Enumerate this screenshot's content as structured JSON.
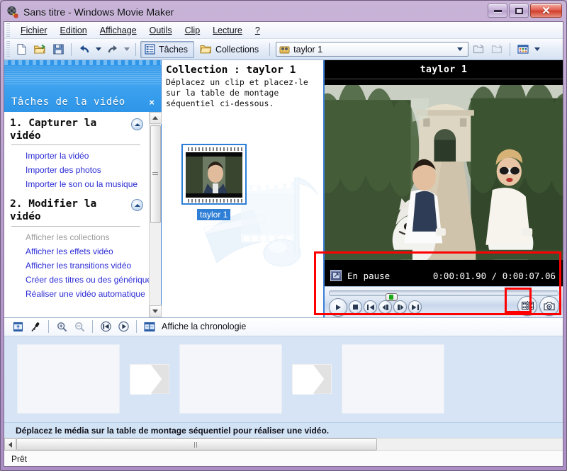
{
  "window": {
    "title": "Sans titre - Windows Movie Maker",
    "app_icon": "movie-reel-icon",
    "minimize": "Réduire",
    "restore": "Agrandir",
    "close": "Fermer"
  },
  "menu": [
    {
      "label": "Fichier",
      "accel": "F"
    },
    {
      "label": "Edition",
      "accel": "E"
    },
    {
      "label": "Affichage",
      "accel": "A"
    },
    {
      "label": "Outils",
      "accel": "O"
    },
    {
      "label": "Clip",
      "accel": "C"
    },
    {
      "label": "Lecture",
      "accel": "L"
    },
    {
      "label": "?",
      "accel": ""
    }
  ],
  "toolbar": {
    "new_title": "Nouveau projet",
    "open_title": "Ouvrir le projet",
    "save_title": "Enregistrer le projet",
    "undo_title": "Annuler",
    "redo_title": "Rétablir",
    "tasks_label": "Tâches",
    "collections_label": "Collections",
    "collection_value": "taylor 1",
    "views_title": "Affichages"
  },
  "task_pane": {
    "title": "Tâches de la vidéo",
    "close": "×",
    "sections": [
      {
        "heading": "1. Capturer la vidéo",
        "links": [
          {
            "label": "Importer la vidéo",
            "disabled": false
          },
          {
            "label": "Importer des photos",
            "disabled": false
          },
          {
            "label": "Importer le son ou la musique",
            "disabled": false
          }
        ]
      },
      {
        "heading": "2. Modifier la vidéo",
        "links": [
          {
            "label": "Afficher les collections",
            "disabled": true
          },
          {
            "label": "Afficher les effets vidéo",
            "disabled": false
          },
          {
            "label": "Afficher les transitions vidéo",
            "disabled": false
          },
          {
            "label": "Créer des titres ou des génériques",
            "disabled": false
          },
          {
            "label": "Réaliser une vidéo automatique",
            "disabled": false
          }
        ]
      }
    ]
  },
  "collections": {
    "heading": "Collection : taylor 1",
    "hint": "Déplacez un clip et placez-le sur la table de montage séquentiel ci-dessous.",
    "clips": [
      {
        "label": "taylor 1",
        "selected": true
      }
    ]
  },
  "preview": {
    "title": "taylor 1",
    "status_icon": "display-icon",
    "status": "En pause",
    "current_time": "0:00:01.90",
    "separator": "/",
    "total_time": "0:00:07.06",
    "seek_percent": 27,
    "buttons": {
      "play": "Lecture",
      "stop": "Arrêter",
      "prev_frame_back": "Clip précédent",
      "back_frame": "Image précédente",
      "fwd_frame": "Image suivante",
      "next_clip": "Clip suivant",
      "split": "Fractionner le clip",
      "snapshot": "Prendre une photo"
    }
  },
  "storyboard": {
    "toolbar": {
      "storyboard_title": "Table de montage séquentiel",
      "narrate_title": "Narration de la chronologie",
      "zoom_in_title": "Zoom avant",
      "zoom_out_title": "Zoom arrière",
      "rewind_title": "Rembobiner la chronologie",
      "play_title": "Lire la chronologie",
      "view_label": "Affiche la chronologie"
    },
    "hint": "Déplacez le média sur la table de montage séquentiel pour réaliser une vidéo.",
    "cells": [
      "",
      "",
      ""
    ],
    "scroll_percent": 66
  },
  "status_bar": {
    "text": "Prêt"
  },
  "annotations": [
    {
      "name": "transport-highlight"
    },
    {
      "name": "split-button-highlight"
    }
  ],
  "colors": {
    "accent_blue": "#2f7fd6",
    "link_blue": "#2c2cd6",
    "annotation_red": "#ff0000",
    "title_purple": "#b9a0cd"
  }
}
